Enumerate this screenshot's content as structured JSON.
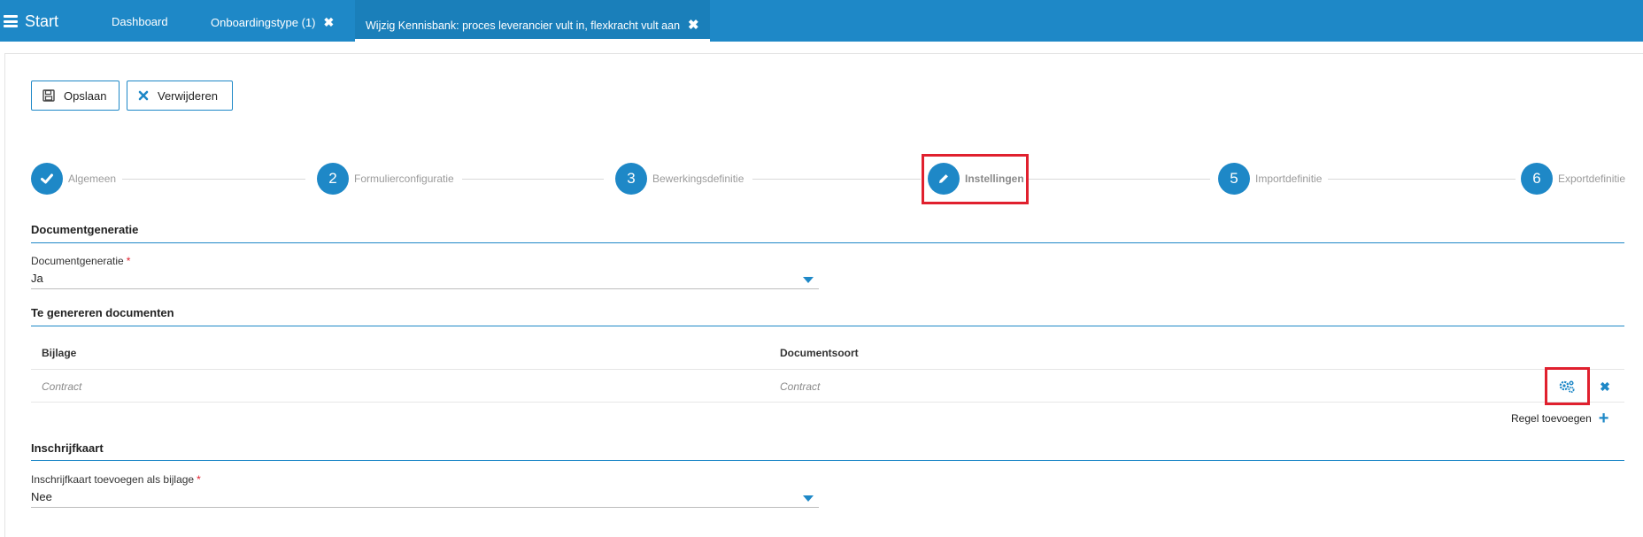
{
  "topbar": {
    "start_label": "Start",
    "tabs": [
      {
        "label": "Dashboard",
        "closable": false
      },
      {
        "label": "Onboardingstype (1)",
        "closable": true,
        "close": "✖"
      },
      {
        "label": "Wijzig Kennisbank: proces leverancier vult in, flexkracht vult aan",
        "closable": true,
        "close": "✖",
        "active": true
      }
    ]
  },
  "toolbar": {
    "save_label": "Opslaan",
    "delete_label": "Verwijderen"
  },
  "stepper": {
    "steps": [
      {
        "label": "Algemeen",
        "marker": "✓",
        "state": "done"
      },
      {
        "label": "Formulierconfiguratie",
        "marker": "2",
        "state": "todo"
      },
      {
        "label": "Bewerkingsdefinitie",
        "marker": "3",
        "state": "todo"
      },
      {
        "label": "Instellingen",
        "marker": "pencil-icon",
        "state": "current"
      },
      {
        "label": "Importdefinitie",
        "marker": "5",
        "state": "todo"
      },
      {
        "label": "Exportdefinitie",
        "marker": "6",
        "state": "todo"
      }
    ]
  },
  "documentgeneratie": {
    "section_title": "Documentgeneratie",
    "field_label": "Documentgeneratie",
    "required_mark": "*",
    "value": "Ja"
  },
  "te_genereren": {
    "section_title": "Te genereren documenten",
    "columns": [
      "Bijlage",
      "Documentsoort"
    ],
    "rows": [
      {
        "bijlage": "Contract",
        "documentsoort": "Contract"
      }
    ],
    "add_row_label": "Regel toevoegen",
    "add_row_icon": "+",
    "delete_icon": "✖"
  },
  "inschrijfkaart": {
    "section_title": "Inschrijfkaart",
    "field_label": "Inschrijfkaart toevoegen als bijlage",
    "required_mark": "*",
    "value": "Nee"
  },
  "colors": {
    "brand": "#1e88c7",
    "highlight": "#e0202e"
  }
}
